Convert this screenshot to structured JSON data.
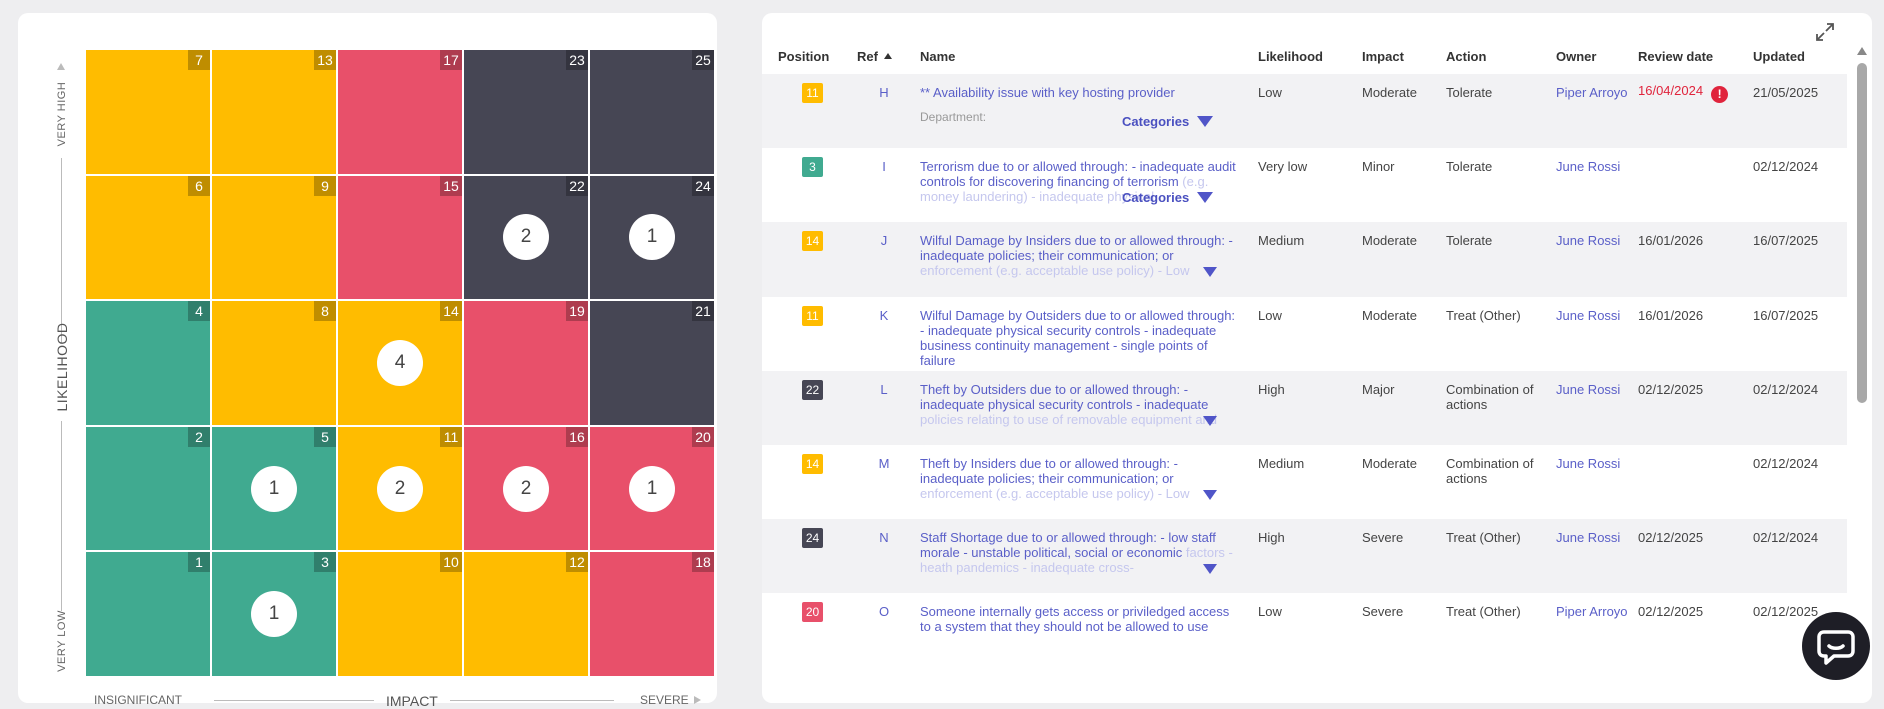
{
  "matrix": {
    "likelihood_axis": {
      "title": "LIKELIHOOD",
      "high": "VERY HIGH",
      "low": "VERY LOW"
    },
    "impact_axis": {
      "title": "IMPACT",
      "low": "INSIGNIFICANT",
      "high": "SEVERE"
    },
    "palette": {
      "yellow": "#ffbc00",
      "red": "#e8506a",
      "dark": "#464654",
      "green": "#40aa90"
    },
    "rows": [
      [
        {
          "n": "7",
          "c": "yellow",
          "count": ""
        },
        {
          "n": "13",
          "c": "yellow",
          "count": ""
        },
        {
          "n": "17",
          "c": "red",
          "count": ""
        },
        {
          "n": "23",
          "c": "dark",
          "count": ""
        },
        {
          "n": "25",
          "c": "dark",
          "count": ""
        }
      ],
      [
        {
          "n": "6",
          "c": "yellow",
          "count": ""
        },
        {
          "n": "9",
          "c": "yellow",
          "count": ""
        },
        {
          "n": "15",
          "c": "red",
          "count": ""
        },
        {
          "n": "22",
          "c": "dark",
          "count": "2"
        },
        {
          "n": "24",
          "c": "dark",
          "count": "1"
        }
      ],
      [
        {
          "n": "4",
          "c": "green",
          "count": ""
        },
        {
          "n": "8",
          "c": "yellow",
          "count": ""
        },
        {
          "n": "14",
          "c": "yellow",
          "count": "4"
        },
        {
          "n": "19",
          "c": "red",
          "count": ""
        },
        {
          "n": "21",
          "c": "dark",
          "count": ""
        }
      ],
      [
        {
          "n": "2",
          "c": "green",
          "count": ""
        },
        {
          "n": "5",
          "c": "green",
          "count": "1"
        },
        {
          "n": "11",
          "c": "yellow",
          "count": "2"
        },
        {
          "n": "16",
          "c": "red",
          "count": "2"
        },
        {
          "n": "20",
          "c": "red",
          "count": "1"
        }
      ],
      [
        {
          "n": "1",
          "c": "green",
          "count": ""
        },
        {
          "n": "3",
          "c": "green",
          "count": "1"
        },
        {
          "n": "10",
          "c": "yellow",
          "count": ""
        },
        {
          "n": "12",
          "c": "yellow",
          "count": ""
        },
        {
          "n": "18",
          "c": "red",
          "count": ""
        }
      ]
    ]
  },
  "table": {
    "headers": {
      "position": "Position",
      "ref": "Ref",
      "name": "Name",
      "likelihood": "Likelihood",
      "impact": "Impact",
      "action": "Action",
      "owner": "Owner",
      "review_date": "Review date",
      "updated": "Updated"
    },
    "categories_label": "Categories",
    "department_label": "Department:",
    "rows": [
      {
        "pos": "11",
        "pc": "yellow",
        "ref": "H",
        "name": "** Availability issue with key hosting provider",
        "fade": "",
        "likelihood": "Low",
        "impact": "Moderate",
        "action": "Tolerate",
        "owner": "Piper Arroyo",
        "review": "16/04/2024",
        "overdue": true,
        "updated": "21/05/2025",
        "extra": "cat-dept"
      },
      {
        "pos": "3",
        "pc": "green",
        "ref": "I",
        "name": "Terrorism due to or allowed through: - inadequate audit controls for discovering financing of terrorism",
        "fade": "(e.g. money laundering) - inadequate physical",
        "likelihood": "Very low",
        "impact": "Minor",
        "action": "Tolerate",
        "owner": "June Rossi",
        "review": "",
        "overdue": false,
        "updated": "02/12/2024",
        "extra": "cat"
      },
      {
        "pos": "14",
        "pc": "yellow",
        "ref": "J",
        "name": "Wilful Damage by Insiders due to or allowed through: - inadequate policies; their communication; or",
        "fade": "enforcement (e.g. acceptable use policy) - Low",
        "likelihood": "Medium",
        "impact": "Moderate",
        "action": "Tolerate",
        "owner": "June Rossi",
        "review": "16/01/2026",
        "overdue": false,
        "updated": "16/07/2025",
        "extra": "tri"
      },
      {
        "pos": "11",
        "pc": "yellow",
        "ref": "K",
        "name": "Wilful Damage by Outsiders due to or allowed through: - inadequate physical security controls - inadequate business continuity management - single points of failure",
        "fade": "",
        "likelihood": "Low",
        "impact": "Moderate",
        "action": "Treat (Other)",
        "owner": "June Rossi",
        "review": "16/01/2026",
        "overdue": false,
        "updated": "16/07/2025",
        "extra": ""
      },
      {
        "pos": "22",
        "pc": "dark",
        "ref": "L",
        "name": "Theft by Outsiders due to or allowed through: - inadequate physical security controls - inadequate",
        "fade": "policies relating to use of removable equipment and",
        "likelihood": "High",
        "impact": "Major",
        "action": "Combination of actions",
        "owner": "June Rossi",
        "review": "02/12/2025",
        "overdue": false,
        "updated": "02/12/2024",
        "extra": "tri"
      },
      {
        "pos": "14",
        "pc": "yellow",
        "ref": "M",
        "name": "Theft by Insiders due to or allowed through: - inadequate policies; their communication; or",
        "fade": "enforcement (e.g. acceptable use policy) - Low",
        "likelihood": "Medium",
        "impact": "Moderate",
        "action": "Combination of actions",
        "owner": "June Rossi",
        "review": "",
        "overdue": false,
        "updated": "02/12/2024",
        "extra": "tri"
      },
      {
        "pos": "24",
        "pc": "dark",
        "ref": "N",
        "name": "Staff Shortage due to or allowed through: - low staff morale - unstable political, social or economic",
        "fade": "factors - heath pandemics - inadequate cross-",
        "likelihood": "High",
        "impact": "Severe",
        "action": "Treat (Other)",
        "owner": "June Rossi",
        "review": "02/12/2025",
        "overdue": false,
        "updated": "02/12/2024",
        "extra": "tri"
      },
      {
        "pos": "20",
        "pc": "red",
        "ref": "O",
        "name": "Someone internally gets access or priviledged access to a system that they should not be allowed to use",
        "fade": "",
        "likelihood": "Low",
        "impact": "Severe",
        "action": "Treat (Other)",
        "owner": "Piper Arroyo",
        "review": "02/12/2025",
        "overdue": false,
        "updated": "02/12/2025",
        "extra": ""
      }
    ]
  }
}
